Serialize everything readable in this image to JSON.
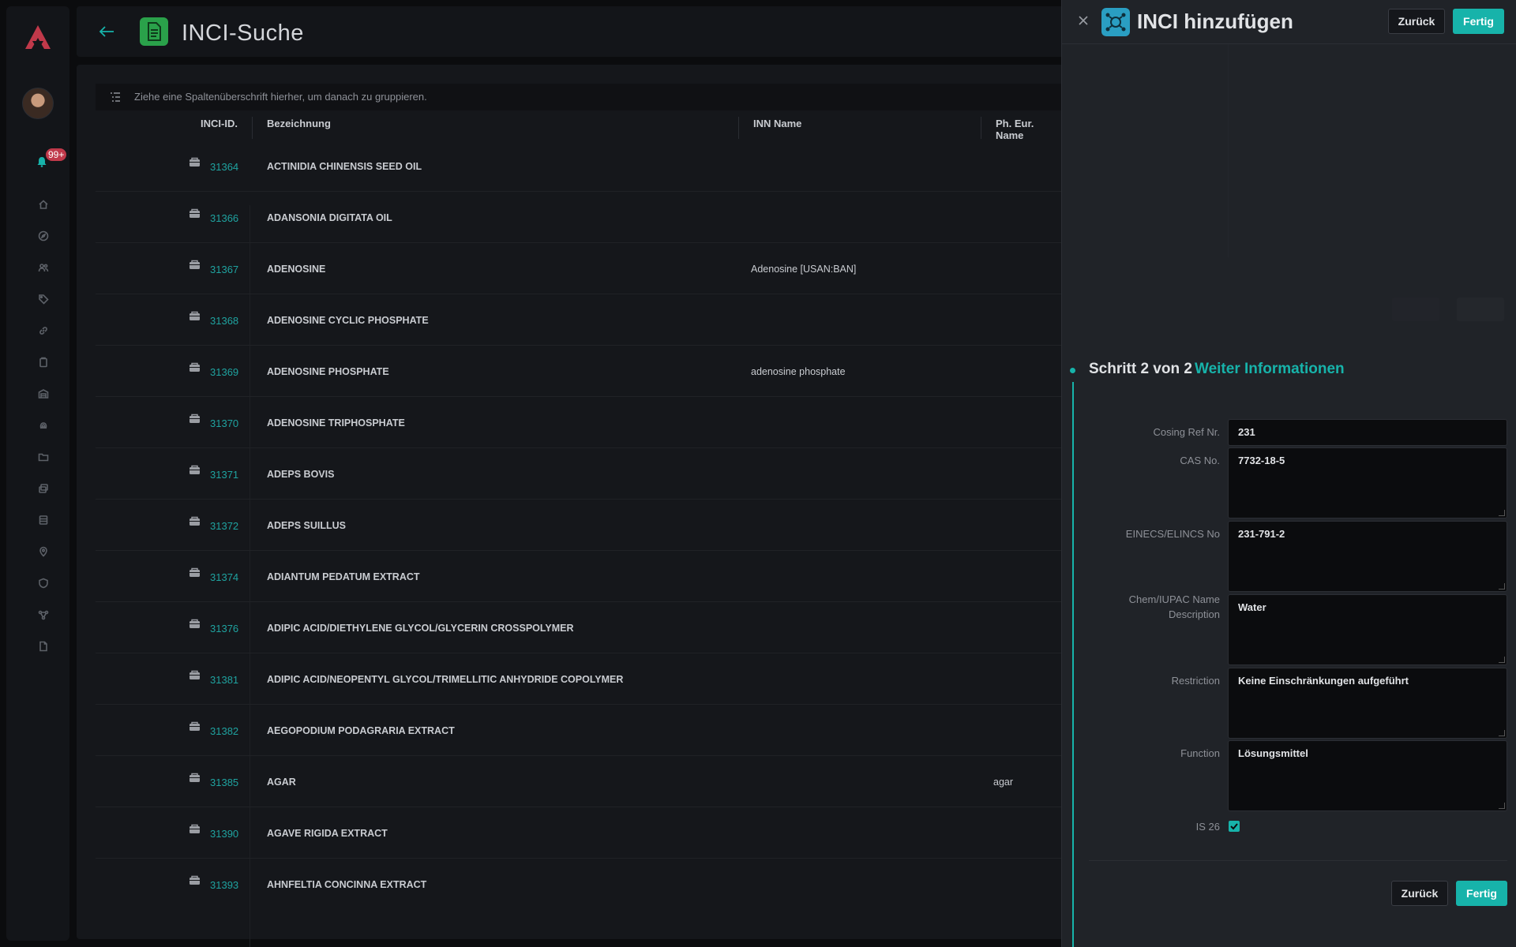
{
  "app": {
    "notifications_badge": "99+"
  },
  "header": {
    "title": "INCI-Suche"
  },
  "grid": {
    "group_hint": "Ziehe eine Spaltenüberschrift hierher, um danach zu gruppieren.",
    "columns": [
      "INCI-ID.",
      "Bezeichnung",
      "INN Name",
      "Ph. Eur. Name"
    ],
    "rows": [
      {
        "id": "31364",
        "name": "ACTINIDIA CHINENSIS SEED OIL",
        "inn": "",
        "eur": ""
      },
      {
        "id": "31366",
        "name": "ADANSONIA DIGITATA OIL",
        "inn": "",
        "eur": ""
      },
      {
        "id": "31367",
        "name": "ADENOSINE",
        "inn": "Adenosine [USAN:BAN]",
        "eur": ""
      },
      {
        "id": "31368",
        "name": "ADENOSINE CYCLIC PHOSPHATE",
        "inn": "",
        "eur": ""
      },
      {
        "id": "31369",
        "name": "ADENOSINE PHOSPHATE",
        "inn": "adenosine phosphate",
        "eur": ""
      },
      {
        "id": "31370",
        "name": "ADENOSINE TRIPHOSPHATE",
        "inn": "",
        "eur": ""
      },
      {
        "id": "31371",
        "name": "ADEPS BOVIS",
        "inn": "",
        "eur": ""
      },
      {
        "id": "31372",
        "name": "ADEPS SUILLUS",
        "inn": "",
        "eur": ""
      },
      {
        "id": "31374",
        "name": "ADIANTUM PEDATUM EXTRACT",
        "inn": "",
        "eur": ""
      },
      {
        "id": "31376",
        "name": "ADIPIC ACID/DIETHYLENE GLYCOL/GLYCERIN CROSSPOLYMER",
        "inn": "",
        "eur": ""
      },
      {
        "id": "31381",
        "name": "ADIPIC ACID/NEOPENTYL GLYCOL/TRIMELLITIC ANHYDRIDE COPOLYMER",
        "inn": "",
        "eur": ""
      },
      {
        "id": "31382",
        "name": "AEGOPODIUM PODAGRARIA EXTRACT",
        "inn": "",
        "eur": ""
      },
      {
        "id": "31385",
        "name": "AGAR",
        "inn": "",
        "eur": "agar"
      },
      {
        "id": "31390",
        "name": "AGAVE RIGIDA EXTRACT",
        "inn": "",
        "eur": ""
      },
      {
        "id": "31393",
        "name": "AHNFELTIA CONCINNA EXTRACT",
        "inn": "",
        "eur": ""
      }
    ]
  },
  "panel": {
    "title": "INCI hinzufügen",
    "back_label": "Zurück",
    "done_label": "Fertig",
    "step_title": "Schritt 2 von 2",
    "step_subtitle": "Weiter Informationen",
    "fields": {
      "cosing": {
        "label": "Cosing Ref Nr.",
        "value": "231"
      },
      "cas": {
        "label": "CAS No.",
        "value": "7732-18-5"
      },
      "einecs": {
        "label": "EINECS/ELINCS No",
        "value": "231-791-2"
      },
      "chem_line1": "Chem/IUPAC Name",
      "chem_line2": "Description",
      "chem_value": "Water",
      "restriction": {
        "label": "Restriction",
        "value": "Keine Einschränkungen aufgeführt"
      },
      "function": {
        "label": "Function",
        "value": "Lösungsmittel"
      },
      "is26": {
        "label": "IS 26",
        "checked": true
      }
    }
  },
  "colors": {
    "accent": "#17b3aa",
    "link": "#1fa3a0",
    "header_icon": "#2aa14a",
    "panel_icon": "#2a9ec2",
    "badge": "#c0394a"
  }
}
